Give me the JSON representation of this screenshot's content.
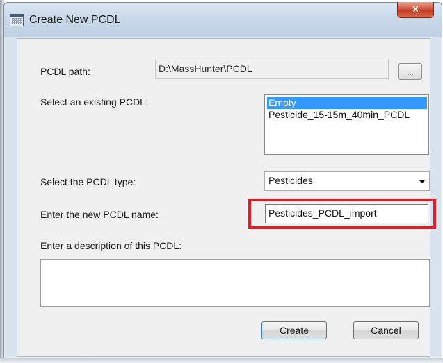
{
  "window": {
    "title": "Create New PCDL",
    "close_symbol": "X",
    "icon": "database-grid-icon"
  },
  "form": {
    "path_label": "PCDL path:",
    "path_value": "D:\\MassHunter\\PCDL",
    "browse_label": "...",
    "existing_label": "Select an existing PCDL:",
    "existing_items": [
      {
        "label": "Empty",
        "selected": true
      },
      {
        "label": "Pesticide_15-15m_40min_PCDL",
        "selected": false
      }
    ],
    "type_label": "Select the PCDL type:",
    "type_value": "Pesticides",
    "name_label": "Enter the new PCDL name:",
    "name_value": "Pesticides_PCDL_import",
    "description_label": "Enter a description of this PCDL:",
    "description_value": ""
  },
  "buttons": {
    "create": "Create",
    "cancel": "Cancel"
  },
  "colors": {
    "highlight": "#e01e24",
    "selection": "#3399ff",
    "close_button": "#c23b22"
  }
}
